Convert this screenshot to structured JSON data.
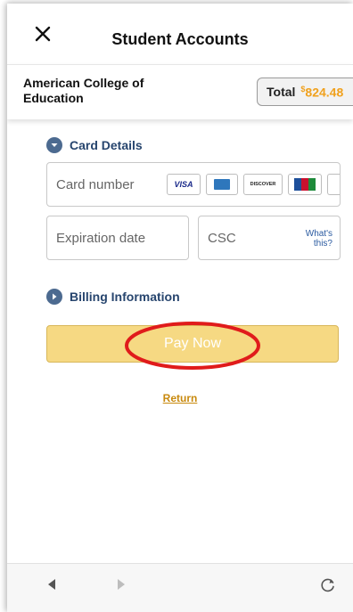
{
  "header": {
    "close_icon": "close-icon",
    "title": "Student Accounts"
  },
  "merchant": {
    "name": "American College of Education",
    "total_label": "Total",
    "currency_symbol": "$",
    "total_amount": "824.48"
  },
  "card_details": {
    "section_label": "Card Details",
    "card_number_placeholder": "Card number",
    "card_brands": [
      "VISA",
      "AMEX",
      "DISCOVER",
      "JCB"
    ],
    "expiration_placeholder": "Expiration date",
    "csc_placeholder": "CSC",
    "whats_this_line1": "What's",
    "whats_this_line2": "this?"
  },
  "billing": {
    "section_label": "Billing Information"
  },
  "actions": {
    "pay_now_label": "Pay Now",
    "return_label": "Return"
  },
  "colors": {
    "accent_orange": "#f0a11d",
    "pay_button": "#f6d983",
    "section_blue": "#27456e",
    "highlight_red": "#e01b1b"
  },
  "bottom_nav": {
    "back_icon": "triangle-left-icon",
    "forward_icon": "triangle-right-icon",
    "reload_icon": "reload-icon"
  }
}
